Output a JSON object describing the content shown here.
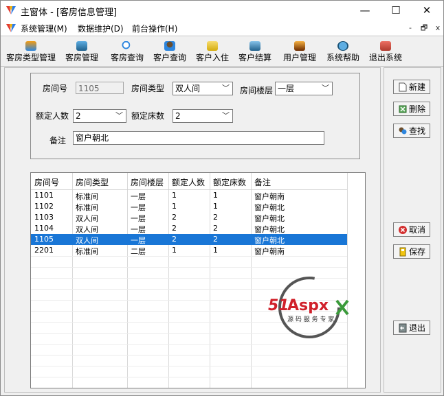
{
  "window": {
    "title": "主窗体 - [客房信息管理]",
    "controls": {
      "minimize": "—",
      "maximize": "☐",
      "close": "✕"
    }
  },
  "menu": {
    "items": [
      "系统管理(M)",
      "数据维护(D)",
      "前台操作(H)"
    ],
    "mdi_controls": [
      "-",
      "🗗",
      "x"
    ]
  },
  "toolbar": {
    "buttons": [
      "客房类型管理",
      "客房管理",
      "客房查询",
      "客户查询",
      "客户入住",
      "客户结算",
      "用户管理",
      "系统帮助",
      "退出系统"
    ]
  },
  "form": {
    "room_no_label": "房间号",
    "room_no_value": "1105",
    "room_type_label": "房间类型",
    "room_type_value": "双人间",
    "floor_label": "房间楼层",
    "floor_value": "一层",
    "capacity_label": "额定人数",
    "capacity_value": "2",
    "beds_label": "额定床数",
    "beds_value": "2",
    "note_label": "备注",
    "note_value": "窗户朝北"
  },
  "grid": {
    "columns": [
      "房间号",
      "房间类型",
      "房间楼层",
      "额定人数",
      "额定床数",
      "备注"
    ],
    "rows": [
      [
        "1101",
        "标准间",
        "一层",
        "1",
        "1",
        "窗户朝南"
      ],
      [
        "1102",
        "标准间",
        "一层",
        "1",
        "1",
        "窗户朝北"
      ],
      [
        "1103",
        "双人间",
        "一层",
        "2",
        "2",
        "窗户朝北"
      ],
      [
        "1104",
        "双人间",
        "一层",
        "2",
        "2",
        "窗户朝北"
      ],
      [
        "1105",
        "双人间",
        "一层",
        "2",
        "2",
        "窗户朝北"
      ],
      [
        "2201",
        "标准间",
        "二层",
        "1",
        "1",
        "窗户朝南"
      ]
    ],
    "selected_row": 4
  },
  "side_buttons": {
    "new": "新建",
    "delete": "删除",
    "find": "查找",
    "cancel": "取消",
    "save": "保存",
    "exit": "退出"
  },
  "watermark": {
    "brand": "51Aspx",
    "tagline": "源码服务专家"
  },
  "colors": {
    "selection": "#1976d6",
    "watermark_red": "#d0202a",
    "watermark_green": "#3a9a3a"
  }
}
